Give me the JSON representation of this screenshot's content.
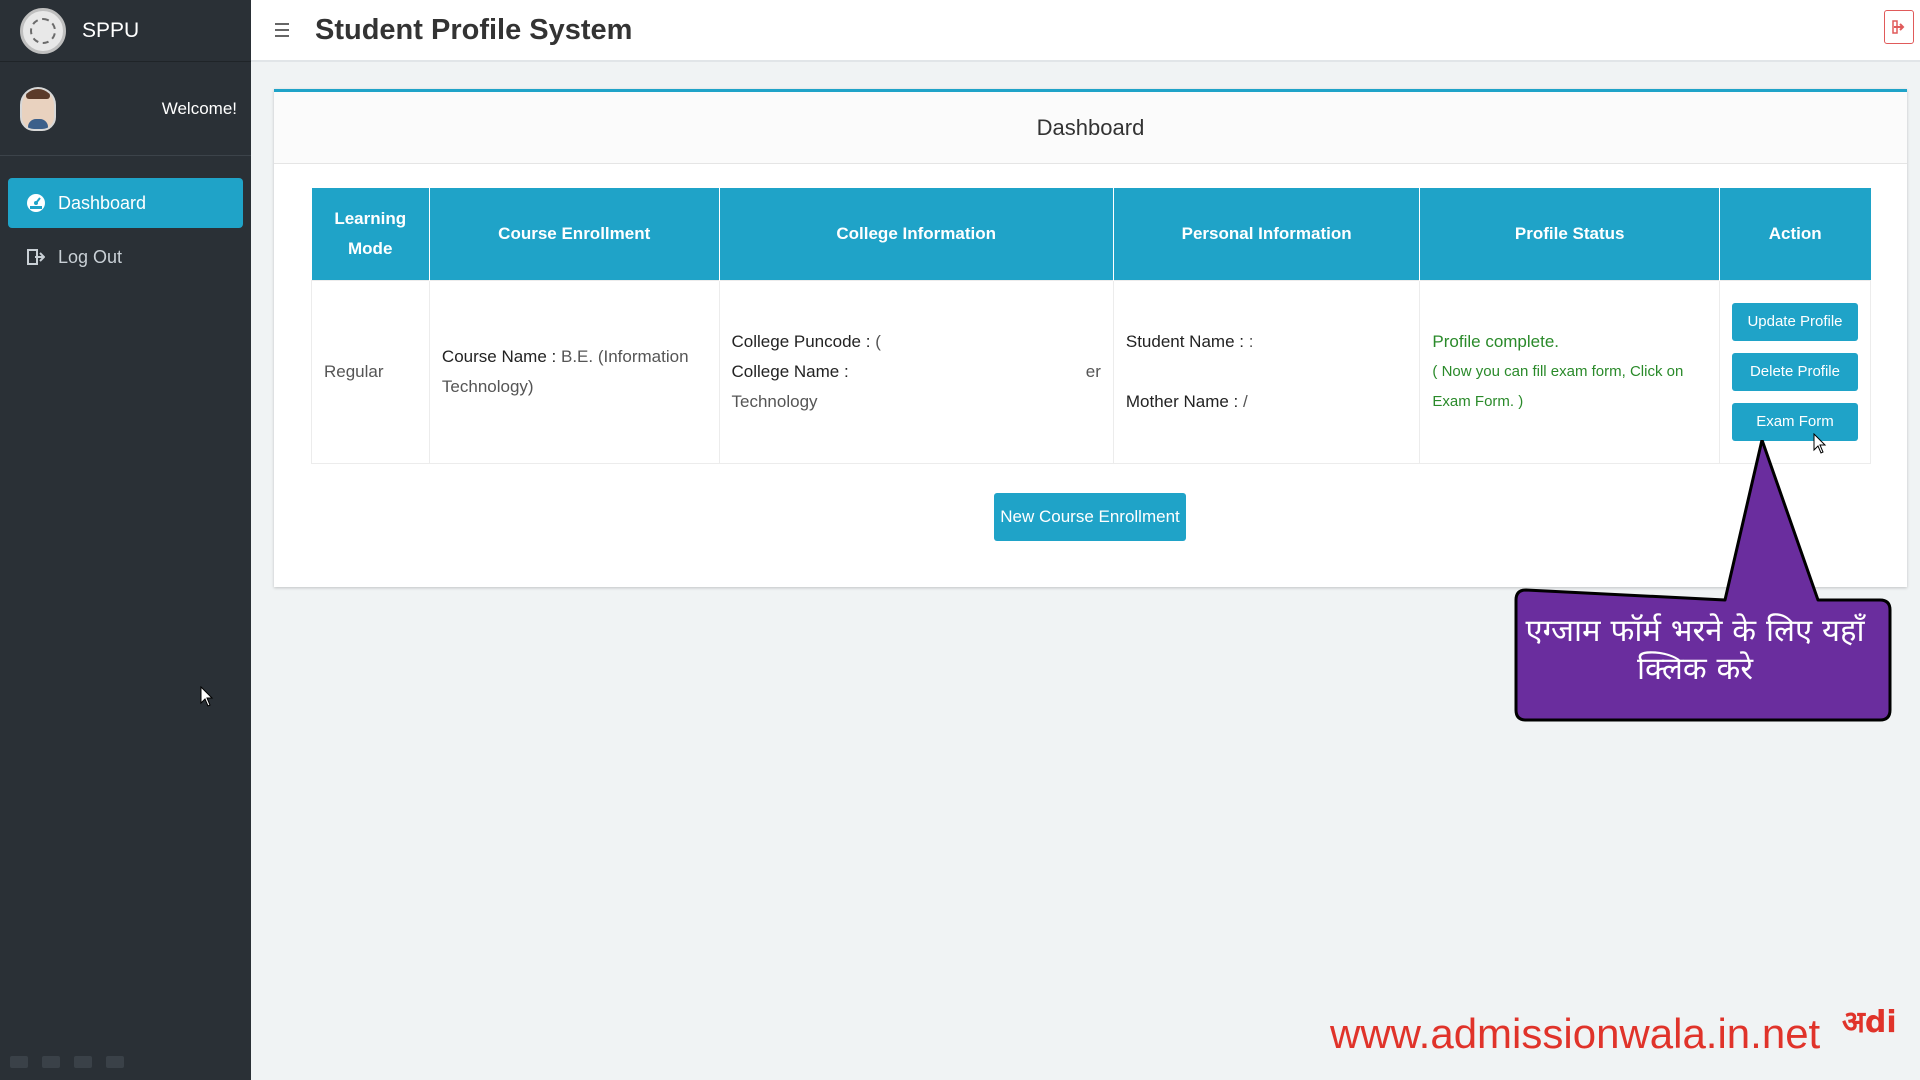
{
  "app": {
    "brand": "SPPU",
    "title": "Student Profile System"
  },
  "sidebar": {
    "welcome": "Welcome!",
    "items": [
      {
        "label": "Dashboard",
        "icon": "dashboard-icon",
        "active": true
      },
      {
        "label": "Log Out",
        "icon": "logout-icon",
        "active": false
      }
    ]
  },
  "panel": {
    "heading": "Dashboard"
  },
  "table": {
    "headers": [
      "Learning Mode",
      "Course Enrollment",
      "College Information",
      "Personal Information",
      "Profile Status",
      "Action"
    ],
    "row": {
      "learning_mode": "Regular",
      "course_label": "Course Name :",
      "course_value": "B.E. (Information Technology)",
      "puncode_label": "College Puncode :",
      "puncode_value": "(",
      "college_name_label": "College Name :",
      "college_name_fragment": "er",
      "college_name_value": "Technology",
      "student_name_label": "Student Name :",
      "student_name_value": ":",
      "mother_name_label": "Mother Name :",
      "mother_name_value": "/",
      "status_main": "Profile complete.",
      "status_sub": "( Now you can fill exam form, Click on Exam Form. )",
      "actions": {
        "update": "Update Profile",
        "delete": "Delete Profile",
        "exam": "Exam Form"
      }
    }
  },
  "new_enrollment_label": "New Course Enrollment",
  "callout": {
    "text": "एग्जाम फॉर्म भरने के लिए यहाँ क्लिक करे",
    "color": "#6a2d9e"
  },
  "watermark": {
    "text": "www.admissionwala.in.net",
    "logo": "अdi"
  },
  "colors": {
    "accent": "#1fa3c8",
    "sidebar": "#2a3036",
    "status": "#2a8a2a"
  }
}
